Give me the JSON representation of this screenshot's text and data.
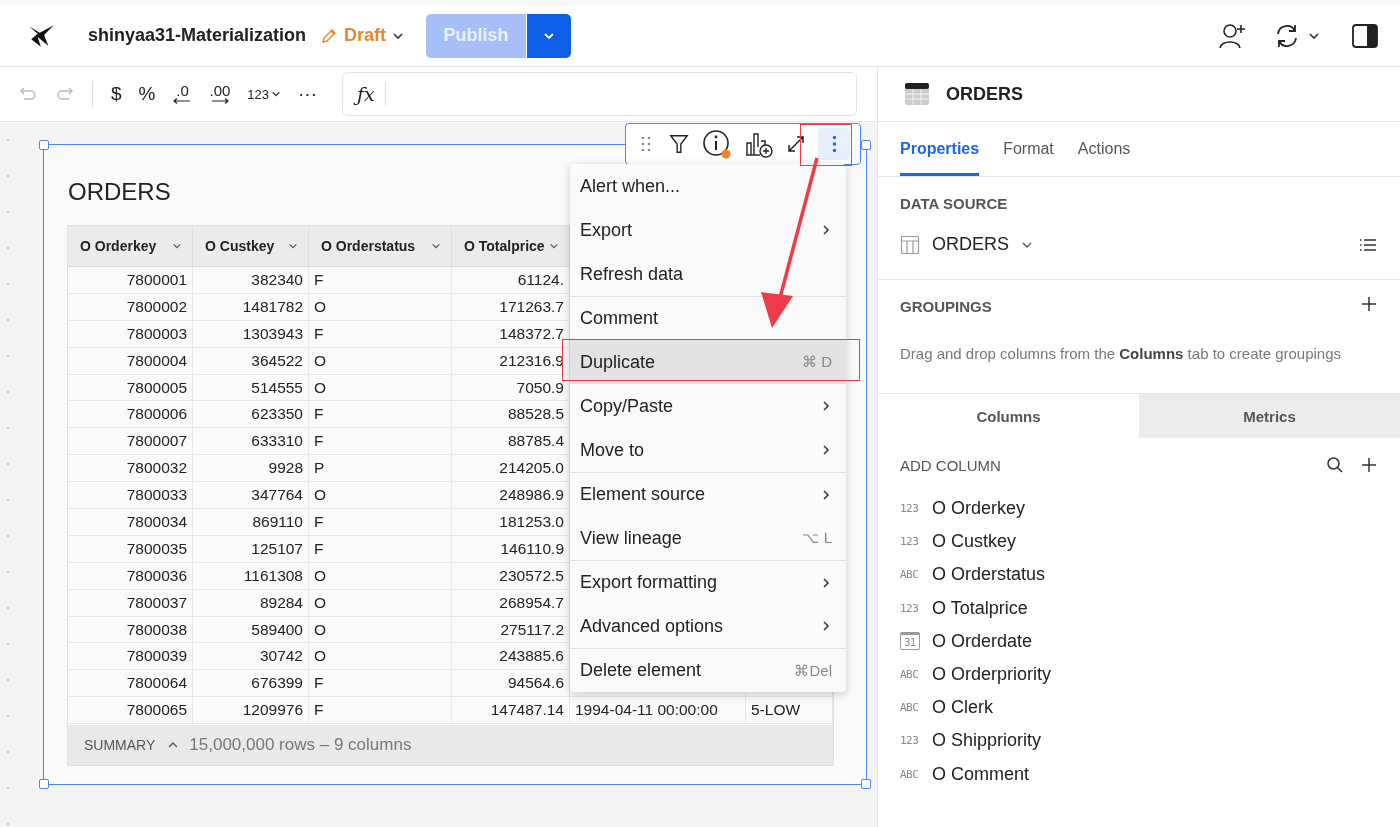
{
  "header": {
    "title": "shinyaa31-Materialization",
    "status": "Draft",
    "publish": {
      "label": "Publish",
      "disabled": true
    }
  },
  "format_toolbar": [
    {
      "kind": "undo",
      "disabled": true
    },
    {
      "kind": "redo",
      "disabled": true
    },
    {
      "kind": "symbol",
      "label": "$"
    },
    {
      "kind": "symbol",
      "label": "%"
    },
    {
      "kind": "decimal-decrease",
      "label": ".0"
    },
    {
      "kind": "decimal-increase",
      "label": ".00"
    },
    {
      "kind": "dropdown",
      "label": "123"
    },
    {
      "kind": "symbol",
      "label": "···"
    }
  ],
  "formula_bar": {
    "label": "ƒx"
  },
  "element": {
    "title": "ORDERS",
    "columns": [
      "O Orderkey",
      "O Custkey",
      "O Orderstatus",
      "O Totalprice"
    ],
    "rows": [
      [
        "7800001",
        "382340",
        "F",
        "61124."
      ],
      [
        "7800002",
        "1481782",
        "O",
        "171263.7"
      ],
      [
        "7800003",
        "1303943",
        "F",
        "148372.7"
      ],
      [
        "7800004",
        "364522",
        "O",
        "212316.9"
      ],
      [
        "7800005",
        "514555",
        "O",
        "7050.9"
      ],
      [
        "7800006",
        "623350",
        "F",
        "88528.5"
      ],
      [
        "7800007",
        "633310",
        "F",
        "88785.4"
      ],
      [
        "7800032",
        "9928",
        "P",
        "214205.0"
      ],
      [
        "7800033",
        "347764",
        "O",
        "248986.9"
      ],
      [
        "7800034",
        "869110",
        "F",
        "181253.0"
      ],
      [
        "7800035",
        "125107",
        "F",
        "146110.9"
      ],
      [
        "7800036",
        "1161308",
        "O",
        "230572.5"
      ],
      [
        "7800037",
        "89284",
        "O",
        "268954.7"
      ],
      [
        "7800038",
        "589400",
        "O",
        "275117.2"
      ],
      [
        "7800039",
        "30742",
        "O",
        "243885.6"
      ],
      [
        "7800064",
        "676399",
        "F",
        "94564.6"
      ],
      [
        "7800065",
        "1209976",
        "F",
        "147487.14",
        "1994-04-11 00:00:00",
        "5-LOW"
      ]
    ],
    "summary": {
      "label": "SUMMARY",
      "text": "15,000,000 rows – 9 columns"
    }
  },
  "context_menu": [
    {
      "label": "Alert when...",
      "submenu": false,
      "separator": false,
      "selected": false
    },
    {
      "label": "Export",
      "submenu": true,
      "separator": false,
      "selected": false
    },
    {
      "label": "Refresh data",
      "submenu": false,
      "separator": false,
      "selected": false
    },
    {
      "label": "Comment",
      "submenu": false,
      "separator": true,
      "selected": false
    },
    {
      "label": "Duplicate",
      "shortcut": "⌘ D",
      "submenu": false,
      "separator": false,
      "selected": true
    },
    {
      "label": "Copy/Paste",
      "submenu": true,
      "separator": false,
      "selected": false
    },
    {
      "label": "Move to",
      "submenu": true,
      "separator": false,
      "selected": false
    },
    {
      "label": "Element source",
      "submenu": true,
      "separator": true,
      "selected": false
    },
    {
      "label": "View lineage",
      "shortcut": "⌥ L",
      "submenu": false,
      "separator": false,
      "selected": false
    },
    {
      "label": "Export formatting",
      "submenu": true,
      "separator": true,
      "selected": false
    },
    {
      "label": "Advanced options",
      "submenu": true,
      "separator": false,
      "selected": false
    },
    {
      "label": "Delete element",
      "shortcut": "⌘Del",
      "submenu": false,
      "separator": true,
      "selected": false
    }
  ],
  "panel": {
    "title": "ORDERS",
    "tabs": [
      {
        "label": "Properties",
        "selected": true
      },
      {
        "label": "Format",
        "selected": false
      },
      {
        "label": "Actions",
        "selected": false
      }
    ],
    "data_source": {
      "label": "DATA SOURCE",
      "value": "ORDERS"
    },
    "groupings": {
      "label": "GROUPINGS",
      "hint": "Drag and drop columns from the **Columns** tab to create groupings"
    },
    "subtabs": [
      {
        "label": "Columns",
        "selected": true
      },
      {
        "label": "Metrics",
        "selected": false
      }
    ],
    "add_column": "ADD COLUMN",
    "columns": [
      {
        "kind": "number",
        "type_label": "123",
        "name": "O Orderkey"
      },
      {
        "kind": "number",
        "type_label": "123",
        "name": "O Custkey"
      },
      {
        "kind": "text",
        "type_label": "ABC",
        "name": "O Orderstatus"
      },
      {
        "kind": "number",
        "type_label": "123",
        "name": "O Totalprice"
      },
      {
        "kind": "date",
        "type_label": "31",
        "name": "O Orderdate"
      },
      {
        "kind": "text",
        "type_label": "ABC",
        "name": "O Orderpriority"
      },
      {
        "kind": "text",
        "type_label": "ABC",
        "name": "O Clerk"
      },
      {
        "kind": "number",
        "type_label": "123",
        "name": "O Shippriority"
      },
      {
        "kind": "text",
        "type_label": "ABC",
        "name": "O Comment"
      }
    ]
  }
}
